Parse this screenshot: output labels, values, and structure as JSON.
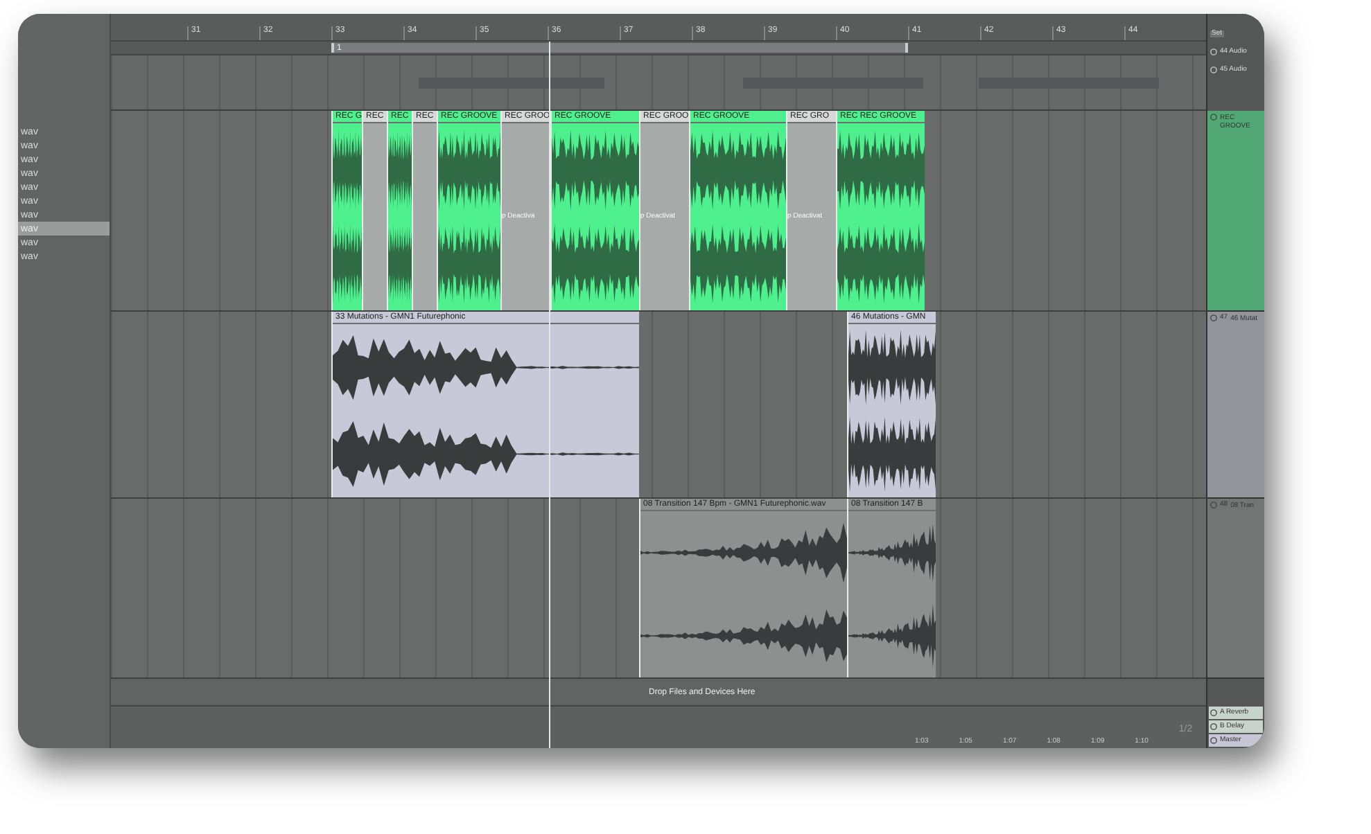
{
  "browser": {
    "items": [
      {
        "name": "wav",
        "selected": false
      },
      {
        "name": "wav",
        "selected": false
      },
      {
        "name": "wav",
        "selected": false
      },
      {
        "name": "wav",
        "selected": false
      },
      {
        "name": "wav",
        "selected": false
      },
      {
        "name": "wav",
        "selected": false
      },
      {
        "name": "wav",
        "selected": false
      },
      {
        "name": "wav",
        "selected": true
      },
      {
        "name": "wav",
        "selected": false
      },
      {
        "name": "wav",
        "selected": false
      }
    ]
  },
  "ruler": {
    "bars": [
      "31",
      "32",
      "33",
      "34",
      "35",
      "36",
      "37",
      "38",
      "39",
      "40",
      "41",
      "42",
      "43",
      "44"
    ],
    "loop_label": "1"
  },
  "tracks": [
    {
      "color": "#4ef08e",
      "clips": [
        {
          "name": "REC G",
          "deactivated": false
        },
        {
          "name": "REC",
          "deactivated": true
        },
        {
          "name": "REC",
          "deactivated": false
        },
        {
          "name": "REC",
          "deactivated": true
        },
        {
          "name": "REC GROOVE",
          "deactivated": false
        },
        {
          "name": "REC GROO",
          "deactivated": true,
          "status": "p Deactiva"
        },
        {
          "name": "REC GROOVE",
          "deactivated": false
        },
        {
          "name": "REC GROO",
          "deactivated": true,
          "status": "p Deactivat"
        },
        {
          "name": "REC GROOVE",
          "deactivated": false
        },
        {
          "name": "REC GRO",
          "deactivated": true,
          "status": "p Deactivat"
        },
        {
          "name": "REC REC GROOVE",
          "deactivated": false
        }
      ]
    },
    {
      "color": "#c9c8d8",
      "clips": [
        {
          "name": "33 Mutations - GMN1 Futurephonic",
          "deactivated": false
        },
        {
          "name": "46 Mutations - GMN",
          "deactivated": false
        }
      ]
    },
    {
      "color": "#8e9090",
      "clips": [
        {
          "name": "08 Transition 147 Bpm - GMN1 Futurephonic.wav",
          "deactivated": false
        },
        {
          "name": "08 Transition 147 B",
          "deactivated": false
        }
      ]
    }
  ],
  "drop_zone": "Drop Files and Devices Here",
  "mixer": {
    "set_label": "Set",
    "inputs": [
      "44 Audio",
      "45 Audio"
    ],
    "tracks": [
      {
        "name": "REC GROOVE"
      },
      {
        "number": "47",
        "name": "46 Mutat"
      },
      {
        "number": "48",
        "name": "08 Tran"
      }
    ],
    "returns": [
      "A Reverb",
      "B Delay",
      "Master"
    ],
    "page": "1/2"
  },
  "time_ruler": [
    "1:03",
    "1:05",
    "1:07",
    "1:08",
    "1:09",
    "1:10"
  ]
}
